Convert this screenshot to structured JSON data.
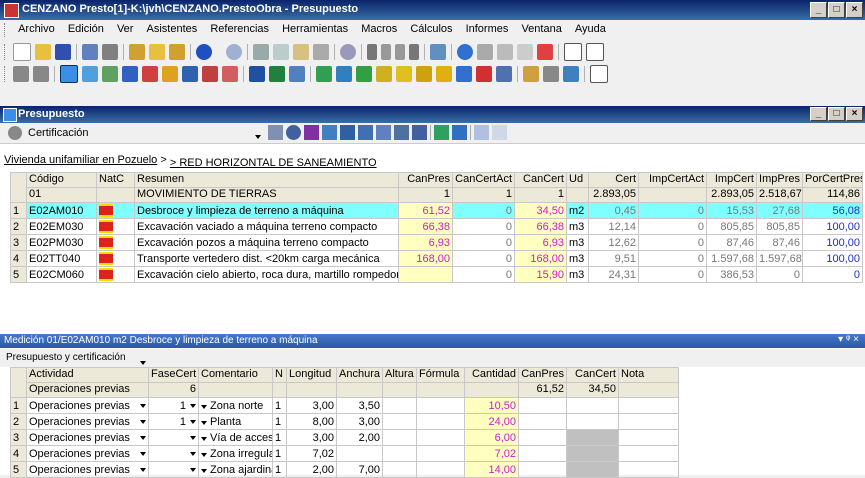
{
  "window": {
    "title": "CENZANO Presto[1]-K:\\jvh\\CENZANO.PrestoObra - Presupuesto"
  },
  "menu": [
    "Archivo",
    "Edición",
    "Ver",
    "Asistentes",
    "Referencias",
    "Herramientas",
    "Macros",
    "Cálculos",
    "Informes",
    "Ventana",
    "Ayuda"
  ],
  "inner": {
    "title": "Presupuesto",
    "mode": "Certificación"
  },
  "breadcrumb": {
    "parent": "Vivienda unifamiliar en Pozuelo",
    "sep": ">",
    "current": "> RED HORIZONTAL DE SANEAMIENTO"
  },
  "top_grid": {
    "headers": {
      "codigo": "Código",
      "natc": "NatC",
      "resumen": "Resumen",
      "canpres": "CanPres",
      "cancertact": "CanCertAct",
      "cancert": "CanCert",
      "ud": "Ud",
      "cert": "Cert",
      "impcertact": "ImpCertAct",
      "impcert": "ImpCert",
      "imppres": "ImpPres",
      "porcertpres": "PorCertPres"
    },
    "parent_row": {
      "codigo": "01",
      "resumen": "MOVIMIENTO DE TIERRAS",
      "canpres": "1",
      "cancertact": "1",
      "cancert": "1",
      "cert": "2.893,05",
      "impcert": "2.893,05",
      "imppres": "2.518,67",
      "porcertpres": "114,86"
    },
    "rows": [
      {
        "n": "1",
        "codigo": "E02AM010",
        "resumen": "Desbroce y limpieza de terreno a máquina",
        "canpres": "61,52",
        "cancertact": "0",
        "cancert": "34,50",
        "ud": "m2",
        "cert": "0,45",
        "impcertact": "0",
        "impcert": "15,53",
        "imppres": "27,68",
        "porcertpres": "56,08"
      },
      {
        "n": "2",
        "codigo": "E02EM030",
        "resumen": "Excavación vaciado a máquina terreno compacto",
        "canpres": "66,38",
        "cancertact": "0",
        "cancert": "66,38",
        "ud": "m3",
        "cert": "12,14",
        "impcertact": "0",
        "impcert": "805,85",
        "imppres": "805,85",
        "porcertpres": "100,00"
      },
      {
        "n": "3",
        "codigo": "E02PM030",
        "resumen": "Excavación pozos a máquina terreno compacto",
        "canpres": "6,93",
        "cancertact": "0",
        "cancert": "6,93",
        "ud": "m3",
        "cert": "12,62",
        "impcertact": "0",
        "impcert": "87,46",
        "imppres": "87,46",
        "porcertpres": "100,00"
      },
      {
        "n": "4",
        "codigo": "E02TT040",
        "resumen": "Transporte vertedero dist. <20km carga mecánica",
        "canpres": "168,00",
        "cancertact": "0",
        "cancert": "168,00",
        "ud": "m3",
        "cert": "9,51",
        "impcertact": "0",
        "impcert": "1.597,68",
        "imppres": "1.597,68",
        "porcertpres": "100,00"
      },
      {
        "n": "5",
        "codigo": "E02CM060",
        "resumen": "Excavación cielo abierto, roca dura, martillo rompedor",
        "canpres": "",
        "cancertact": "0",
        "cancert": "15,90",
        "ud": "m3",
        "cert": "24,31",
        "impcertact": "0",
        "impcert": "386,53",
        "imppres": "0",
        "porcertpres": "0"
      }
    ]
  },
  "medicion": {
    "title": "Medición 01/E02AM010 m2 Desbroce y limpieza de terreno a máquina",
    "filter": "Presupuesto y certificación",
    "pin": "▾ ᵠ ×"
  },
  "bottom_grid": {
    "headers": {
      "actividad": "Actividad",
      "fasecert": "FaseCert",
      "comentario": "Comentario",
      "n": "N",
      "longitud": "Longitud",
      "anchura": "Anchura",
      "altura": "Altura",
      "formula": "Fórmula",
      "cantidad": "Cantidad",
      "canpres": "CanPres",
      "cancert": "CanCert",
      "nota": "Nota"
    },
    "parent_row": {
      "actividad": "Operaciones previas",
      "fasecert": "6",
      "canpres": "61,52",
      "cancert": "34,50"
    },
    "rows": [
      {
        "i": "1",
        "actividad": "Operaciones previas",
        "fasecert": "1",
        "comentario": "Zona norte",
        "n": "1",
        "longitud": "3,00",
        "anchura": "3,50",
        "cantidad": "10,50"
      },
      {
        "i": "2",
        "actividad": "Operaciones previas",
        "fasecert": "1",
        "comentario": "Planta",
        "n": "1",
        "longitud": "8,00",
        "anchura": "3,00",
        "cantidad": "24,00"
      },
      {
        "i": "3",
        "actividad": "Operaciones previas",
        "fasecert": "",
        "comentario": "Vía de acceso",
        "n": "1",
        "longitud": "3,00",
        "anchura": "2,00",
        "cantidad": "6,00"
      },
      {
        "i": "4",
        "actividad": "Operaciones previas",
        "fasecert": "",
        "comentario": "Zona irregular",
        "n": "1",
        "longitud": "7,02",
        "anchura": "",
        "cantidad": "7,02"
      },
      {
        "i": "5",
        "actividad": "Operaciones previas",
        "fasecert": "",
        "comentario": "Zona ajardinada",
        "n": "1",
        "longitud": "2,00",
        "anchura": "7,00",
        "cantidad": "14,00"
      }
    ]
  }
}
